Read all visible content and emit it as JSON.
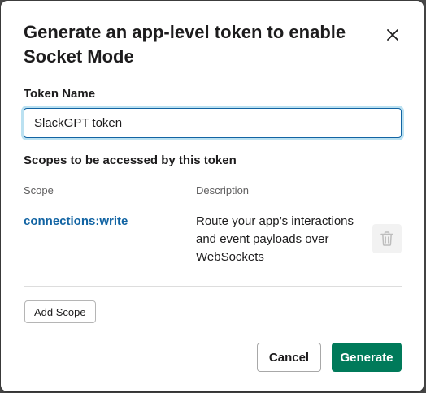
{
  "dialog": {
    "title": "Generate an app-level token to enable Socket Mode",
    "close_icon": "close-icon"
  },
  "token_field": {
    "label": "Token Name",
    "value": "SlackGPT token"
  },
  "scopes": {
    "heading": "Scopes to be accessed by this token",
    "columns": [
      "Scope",
      "Description"
    ],
    "rows": [
      {
        "scope": "connections:write",
        "description": "Route your app’s interactions and event payloads over WebSockets",
        "delete_icon": "trash-icon"
      }
    ],
    "add_label": "Add Scope"
  },
  "footer": {
    "cancel_label": "Cancel",
    "generate_label": "Generate"
  },
  "colors": {
    "link": "#1264a3",
    "primary": "#007a5a",
    "focus_ring": "#1d9bd1"
  }
}
